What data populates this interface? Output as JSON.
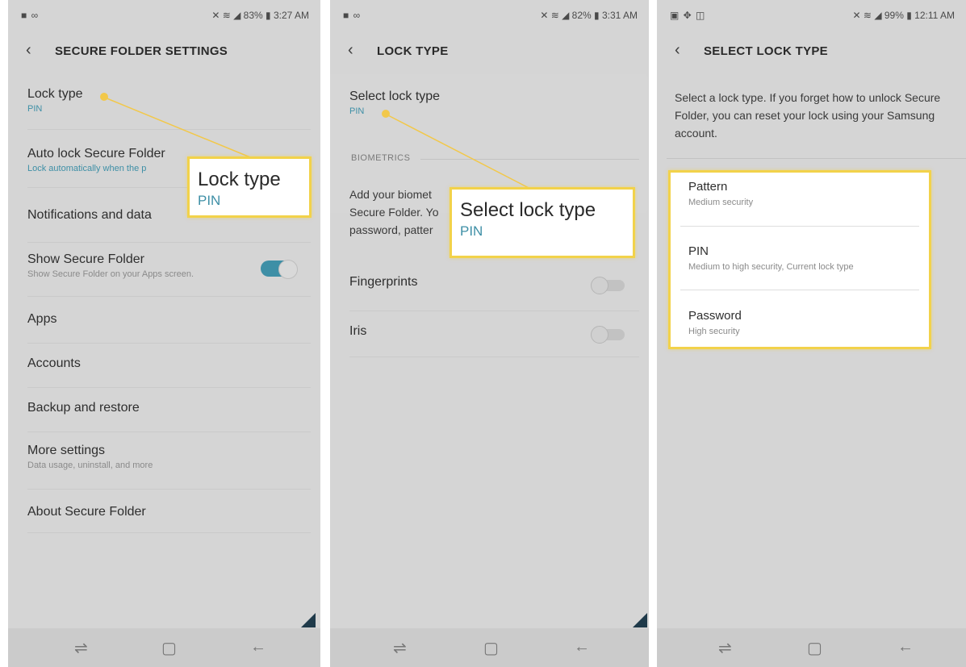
{
  "panel1": {
    "status_left": "■ ∞",
    "status_right": "✕ ≋ ◢ 83% ▮ 3:27 AM",
    "title": "SECURE FOLDER SETTINGS",
    "items": [
      {
        "label": "Lock type",
        "sub": "PIN"
      },
      {
        "label": "Auto lock Secure Folder",
        "sub": "Lock automatically when the p"
      },
      {
        "label": "Notifications and data"
      },
      {
        "label": "Show Secure Folder",
        "sub": "Show Secure Folder on your Apps screen."
      },
      {
        "label": "Apps"
      },
      {
        "label": "Accounts"
      },
      {
        "label": "Backup and restore"
      },
      {
        "label": "More settings",
        "sub": "Data usage, uninstall, and more"
      },
      {
        "label": "About Secure Folder"
      }
    ],
    "show_secure_folder_toggle": "on",
    "callout": {
      "title": "Lock type",
      "value": "PIN"
    }
  },
  "panel2": {
    "status_left": "■ ∞",
    "status_right": "✕ ≋ ◢ 82% ▮ 3:31 AM",
    "title": "LOCK TYPE",
    "select_label": "Select lock type",
    "select_value": "PIN",
    "section": "BIOMETRICS",
    "desc_line1": "Add your biomet",
    "desc_line2": "Secure Folder. Yo",
    "desc_line3": "password, patter",
    "fingerprints": "Fingerprints",
    "iris": "Iris",
    "callout": {
      "title": "Select lock type",
      "value": "PIN"
    }
  },
  "panel3": {
    "status_left": "▣ ✥ ◫",
    "status_right": "✕ ≋ ◢ 99% ▮ 12:11 AM",
    "title": "SELECT LOCK TYPE",
    "description": "Select a lock type. If you forget how to unlock Secure Folder, you can reset your lock using your Samsung account.",
    "options": [
      {
        "label": "Pattern",
        "sub": "Medium security"
      },
      {
        "label": "PIN",
        "sub": "Medium to high security, Current lock type"
      },
      {
        "label": "Password",
        "sub": "High security"
      }
    ]
  },
  "icons": {
    "back": "‹",
    "recents": "⇌",
    "home": "▢",
    "navback": "←"
  },
  "colors": {
    "accent": "#3e8fa6",
    "highlight": "#f2d24a"
  }
}
